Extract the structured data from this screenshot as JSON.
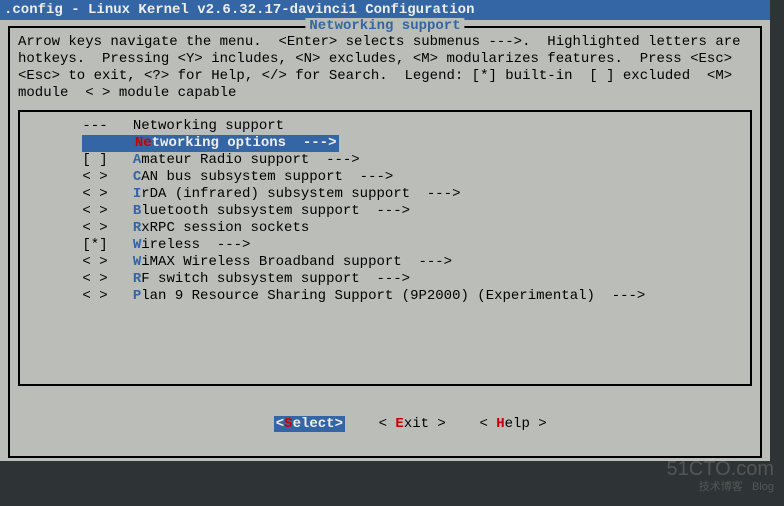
{
  "titlebar": ".config - Linux Kernel v2.6.32.17-davinci1 Configuration",
  "dialog_title": "Networking support",
  "help_text": "Arrow keys navigate the menu.  <Enter> selects submenus --->.  Highlighted letters are hotkeys.  Pressing <Y> includes, <N> excludes, <M> modularizes features.  Press <Esc><Esc> to exit, <?> for Help, </> for Search.  Legend: [*] built-in  [ ] excluded  <M> module  < > module capable",
  "menu": [
    {
      "prefix": "---",
      "hot": "",
      "label": "Networking support",
      "selected": false,
      "arrow": ""
    },
    {
      "prefix": "   ",
      "hot": "Ne",
      "label": "tworking options  --->",
      "selected": true,
      "arrow": ""
    },
    {
      "prefix": "[ ]",
      "hot": "A",
      "label": "mateur Radio support  --->",
      "selected": false,
      "arrow": ""
    },
    {
      "prefix": "< >",
      "hot": "C",
      "label": "AN bus subsystem support  --->",
      "selected": false,
      "arrow": ""
    },
    {
      "prefix": "< >",
      "hot": "I",
      "label": "rDA (infrared) subsystem support  --->",
      "selected": false,
      "arrow": ""
    },
    {
      "prefix": "< >",
      "hot": "B",
      "label": "luetooth subsystem support  --->",
      "selected": false,
      "arrow": ""
    },
    {
      "prefix": "< >",
      "hot": "R",
      "label": "xRPC session sockets",
      "selected": false,
      "arrow": ""
    },
    {
      "prefix": "[*]",
      "hot": "W",
      "label": "ireless  --->",
      "selected": false,
      "arrow": ""
    },
    {
      "prefix": "< >",
      "hot": "W",
      "label": "iMAX Wireless Broadband support  --->",
      "selected": false,
      "arrow": ""
    },
    {
      "prefix": "< >",
      "hot": "R",
      "label": "F switch subsystem support  --->",
      "selected": false,
      "arrow": ""
    },
    {
      "prefix": "< >",
      "hot": "P",
      "label": "lan 9 Resource Sharing Support (9P2000) (Experimental)  --->",
      "selected": false,
      "arrow": ""
    }
  ],
  "buttons": {
    "select": {
      "open": "<",
      "hot": "S",
      "rest": "elect",
      "close": ">"
    },
    "exit": {
      "open": "< ",
      "hot": "E",
      "rest": "xit ",
      "close": ">"
    },
    "help": {
      "open": "< ",
      "hot": "H",
      "rest": "elp ",
      "close": ">"
    }
  },
  "watermark": {
    "main": "51CTO.com",
    "sub": "技术博客",
    "tag": "Blog"
  }
}
